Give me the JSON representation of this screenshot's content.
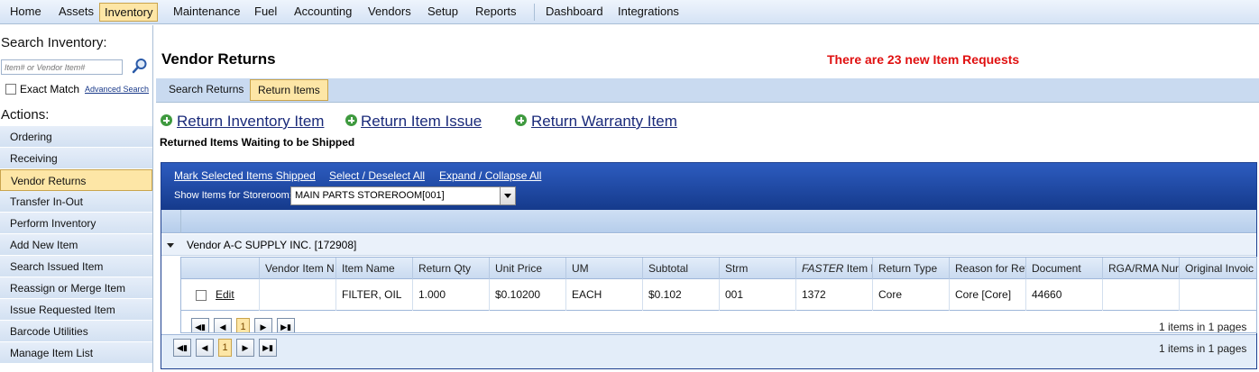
{
  "menu": {
    "items": [
      "Home",
      "Assets",
      "Inventory",
      "Maintenance",
      "Fuel",
      "Accounting",
      "Vendors",
      "Setup",
      "Reports"
    ],
    "items2": [
      "Dashboard",
      "Integrations"
    ],
    "active": "Inventory"
  },
  "sidebar": {
    "search_title": "Search Inventory:",
    "search_placeholder": "Item# or Vendor Item#",
    "exact_match_label": "Exact Match",
    "advanced_search": "Advanced Search",
    "actions_title": "Actions:",
    "actions": [
      "Ordering",
      "Receiving",
      "Vendor Returns",
      "Transfer In-Out",
      "Perform Inventory",
      "Add New Item",
      "Search Issued Item",
      "Reassign or Merge Item",
      "Issue Requested Item",
      "Barcode Utilities",
      "Manage Item List"
    ],
    "active_action": "Vendor Returns"
  },
  "main": {
    "title": "Vendor Returns",
    "notice": "There are 23 new Item Requests",
    "tabs": [
      "Search Returns",
      "Return Items"
    ],
    "active_tab": "Return Items",
    "links": [
      "Return Inventory Item",
      "Return Item Issue",
      "Return Warranty Item"
    ],
    "section_title": "Returned Items Waiting to be Shipped"
  },
  "grid": {
    "header_links": [
      "Mark Selected Items Shipped",
      "Select / Deselect All",
      "Expand / Collapse All"
    ],
    "storeroom_label": "Show Items for Storeroom:",
    "storeroom_value": "MAIN PARTS STOREROOM[001]",
    "group_label": "Vendor    A-C SUPPLY INC. [172908]",
    "columns": [
      "Vendor Item N",
      "Item Name",
      "Return Qty",
      "Unit Price",
      "UM",
      "Subtotal",
      "Strm",
      "Item N",
      "Return Type",
      "Reason for Ret",
      "Document",
      "RGA/RMA Nur",
      "Original Invoic"
    ],
    "faster_prefix": "FASTER",
    "row": {
      "edit": "Edit",
      "vendor_item": "",
      "item_name": "FILTER, OIL",
      "return_qty": "1.000",
      "unit_price": "$0.10200",
      "um": "EACH",
      "subtotal": "$0.102",
      "strm": "001",
      "faster_item": "1372",
      "return_type": "Core",
      "reason": "Core [Core]",
      "document": "44660",
      "rga": "",
      "original_invoice": ""
    },
    "inner_pager": {
      "page": "1",
      "info": "1 items in 1 pages"
    },
    "outer_pager": {
      "page": "1",
      "info": "1 items in 1 pages"
    }
  }
}
